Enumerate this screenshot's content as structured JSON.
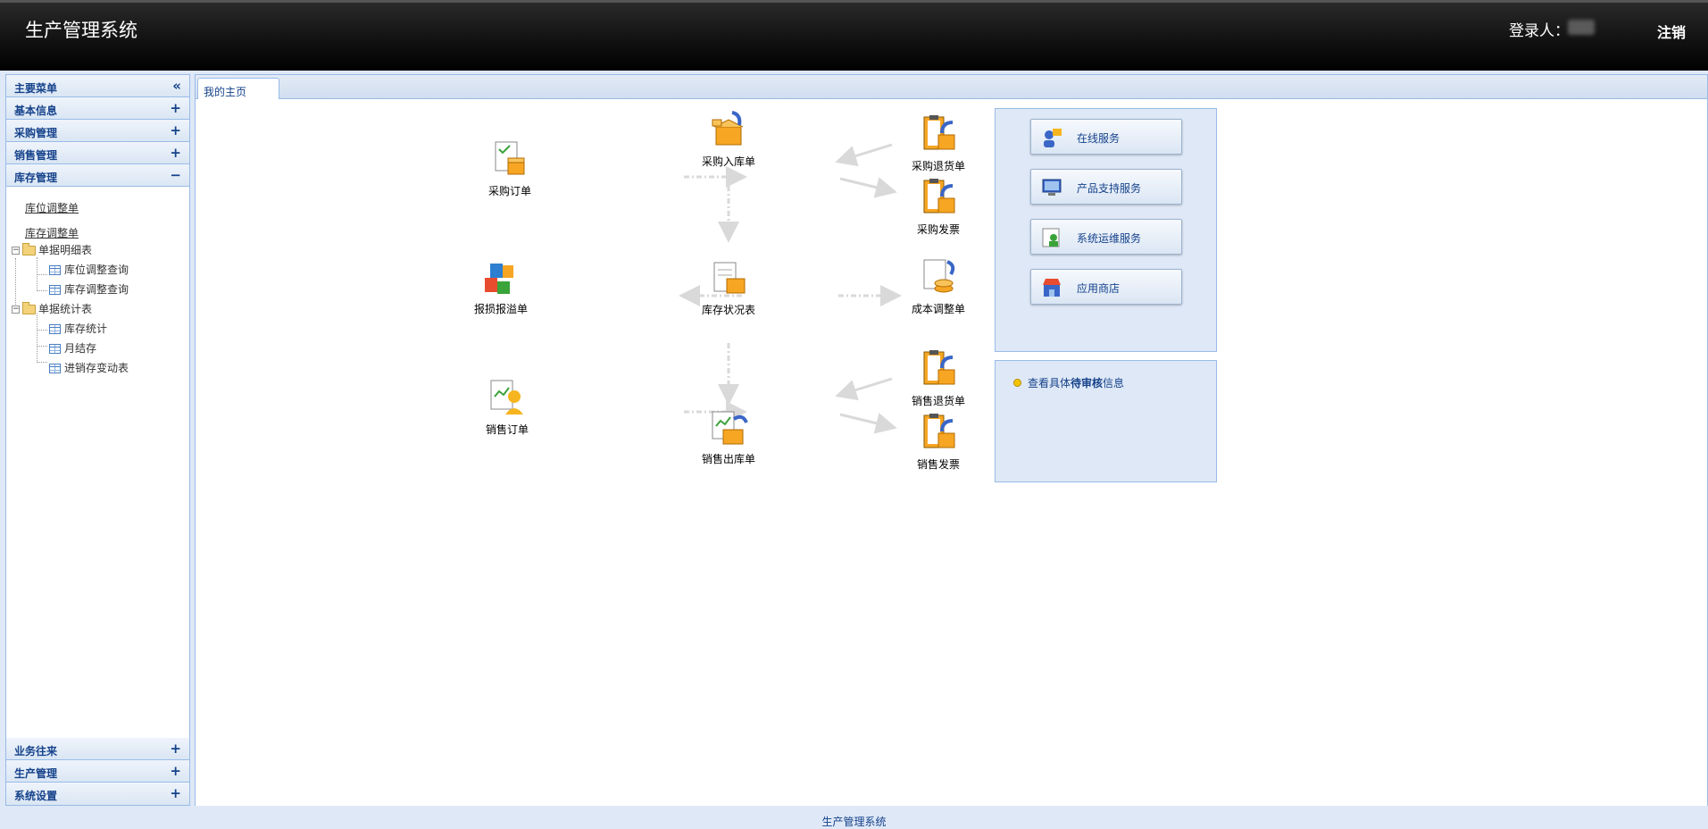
{
  "header": {
    "title": "生产管理系统",
    "login_label": "登录人：",
    "logout": "注销"
  },
  "sidebar": {
    "main_menu": "主要菜单",
    "collapse_icon": "«",
    "sections_top": [
      {
        "label": "基本信息",
        "tool": "+"
      },
      {
        "label": "采购管理",
        "tool": "+"
      },
      {
        "label": "销售管理",
        "tool": "+"
      },
      {
        "label": "库存管理",
        "tool": "−"
      }
    ],
    "inventory": {
      "links": [
        "库位调整单",
        "库存调整单"
      ],
      "tree": {
        "detail_folder": "单据明细表",
        "detail_items": [
          "库位调整查询",
          "库存调整查询"
        ],
        "stats_folder": "单据统计表",
        "stats_items": [
          "库存统计",
          "月结存",
          "进销存变动表"
        ]
      }
    },
    "sections_bottom": [
      {
        "label": "业务往来",
        "tool": "+"
      },
      {
        "label": "生产管理",
        "tool": "+"
      },
      {
        "label": "系统设置",
        "tool": "+"
      }
    ]
  },
  "tabs": {
    "home": "我的主页"
  },
  "flow": {
    "purchase_order": "采购订单",
    "purchase_in": "采购入库单",
    "purchase_return": "采购退货单",
    "purchase_invoice": "采购发票",
    "loss_report": "报损报溢单",
    "stock_status": "库存状况表",
    "cost_adjust": "成本调整单",
    "sales_order": "销售订单",
    "sales_out": "销售出库单",
    "sales_return": "销售退货单",
    "sales_invoice": "销售发票"
  },
  "services": {
    "online": "在线服务",
    "product_support": "产品支持服务",
    "ops": "系统运维服务",
    "app_store": "应用商店"
  },
  "pending": {
    "prefix": "查看具体",
    "bold": "待审核",
    "suffix": "信息"
  },
  "footer": {
    "text": "生产管理系统"
  },
  "colors": {
    "header_bg": "#000000",
    "panel_border": "#99bbe8",
    "panel_bg": "#dfe8f6",
    "link_blue": "#15428b"
  }
}
